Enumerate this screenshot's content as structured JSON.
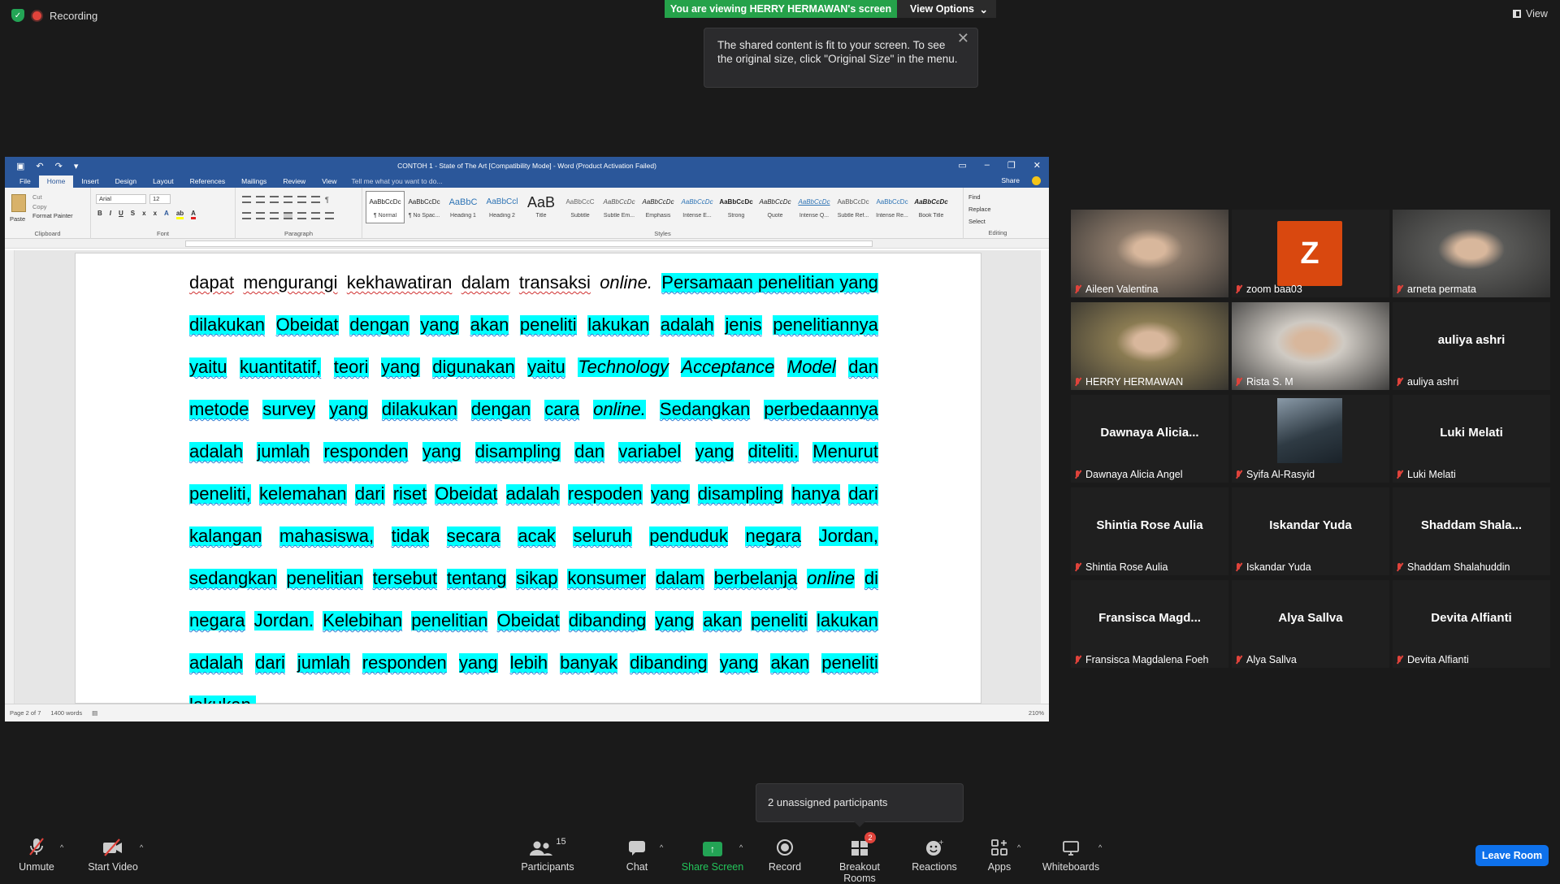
{
  "top": {
    "recording": "Recording",
    "viewing_banner": "You are viewing HERRY HERMAWAN's screen",
    "view_options": "View Options",
    "tooltip": "The shared content is fit to your screen. To see the original size, click \"Original Size\" in the menu.",
    "view_label": "View"
  },
  "word": {
    "title": "CONTOH 1 - State of The Art [Compatibility Mode] - Word (Product Activation Failed)",
    "tabs": [
      "File",
      "Home",
      "Insert",
      "Design",
      "Layout",
      "References",
      "Mailings",
      "Review",
      "View"
    ],
    "tell_me": "Tell me what you want to do...",
    "share": "Share",
    "clipboard": {
      "paste": "Paste",
      "cut": "Cut",
      "copy": "Copy",
      "format_painter": "Format Painter",
      "label": "Clipboard"
    },
    "font": {
      "name": "Arial",
      "size": "12",
      "label": "Font"
    },
    "paragraph_label": "Paragraph",
    "styles_label": "Styles",
    "styles": [
      {
        "preview": "AaBbCcDc",
        "name": "¶ Normal"
      },
      {
        "preview": "AaBbCcDc",
        "name": "¶ No Spac..."
      },
      {
        "preview": "AaBbC",
        "name": "Heading 1"
      },
      {
        "preview": "AaBbCcl",
        "name": "Heading 2"
      },
      {
        "preview": "AaB",
        "name": "Title"
      },
      {
        "preview": "AaBbCcC",
        "name": "Subtitle"
      },
      {
        "preview": "AaBbCcDc",
        "name": "Subtle Em..."
      },
      {
        "preview": "AaBbCcDc",
        "name": "Emphasis"
      },
      {
        "preview": "AaBbCcDc",
        "name": "Intense E..."
      },
      {
        "preview": "AaBbCcDc",
        "name": "Strong"
      },
      {
        "preview": "AaBbCcDc",
        "name": "Quote"
      },
      {
        "preview": "AaBbCcDc",
        "name": "Intense Q..."
      },
      {
        "preview": "AaBbCcDc",
        "name": "Subtle Ref..."
      },
      {
        "preview": "AaBbCcDc",
        "name": "Intense Re..."
      },
      {
        "preview": "AaBbCcDc",
        "name": "Book Title"
      }
    ],
    "editing": {
      "find": "Find",
      "replace": "Replace",
      "select": "Select",
      "label": "Editing"
    },
    "status": {
      "page": "Page 2 of 7",
      "words": "1400 words",
      "zoom": "210%"
    },
    "lines": [
      {
        "segs": [
          {
            "t": "dapat",
            "c": "sqr"
          },
          {
            "t": "mengurangi",
            "c": "sqr"
          },
          {
            "t": "kekhawatiran",
            "c": "sqr"
          },
          {
            "t": "dalam",
            "c": "sqr"
          },
          {
            "t": "transaksi",
            "c": "sqr"
          },
          {
            "t": "online.",
            "c": "it"
          },
          {
            "t": "Persamaan penelitian yang",
            "c": "hl sq"
          }
        ]
      },
      {
        "segs": [
          {
            "t": "dilakukan",
            "c": "hl sq"
          },
          {
            "t": "Obeidat",
            "c": "hl sq"
          },
          {
            "t": "dengan",
            "c": "hl sq"
          },
          {
            "t": "yang",
            "c": "hl sq"
          },
          {
            "t": "akan",
            "c": "hl sq"
          },
          {
            "t": "peneliti",
            "c": "hl sq"
          },
          {
            "t": "lakukan",
            "c": "hl sq"
          },
          {
            "t": "adalah",
            "c": "hl sq"
          },
          {
            "t": "jenis",
            "c": "hl sq"
          },
          {
            "t": "penelitiannya",
            "c": "hl sq"
          }
        ]
      },
      {
        "segs": [
          {
            "t": "yaitu",
            "c": "hl sq"
          },
          {
            "t": "kuantitatif,",
            "c": "hl sq"
          },
          {
            "t": "teori",
            "c": "hl sq"
          },
          {
            "t": "yang",
            "c": "hl sq"
          },
          {
            "t": "digunakan",
            "c": "hl sq"
          },
          {
            "t": "yaitu",
            "c": "hl sq"
          },
          {
            "t": "Technology",
            "c": "hl it"
          },
          {
            "t": "Acceptance",
            "c": "hl it"
          },
          {
            "t": "Model",
            "c": "hl it"
          },
          {
            "t": "dan",
            "c": "hl sq"
          }
        ]
      },
      {
        "segs": [
          {
            "t": "metode",
            "c": "hl sq"
          },
          {
            "t": "survey",
            "c": "hl"
          },
          {
            "t": "yang",
            "c": "hl sq"
          },
          {
            "t": "dilakukan",
            "c": "hl sq"
          },
          {
            "t": "dengan",
            "c": "hl sq"
          },
          {
            "t": "cara",
            "c": "hl sq"
          },
          {
            "t": "online.",
            "c": "hl it"
          },
          {
            "t": "Sedangkan",
            "c": "hl sq"
          },
          {
            "t": "perbedaannya",
            "c": "hl sq"
          }
        ]
      },
      {
        "segs": [
          {
            "t": "adalah",
            "c": "hl sq"
          },
          {
            "t": "jumlah",
            "c": "hl sq"
          },
          {
            "t": "responden",
            "c": "hl sq"
          },
          {
            "t": "yang",
            "c": "hl sq"
          },
          {
            "t": "disampling",
            "c": "hl sq"
          },
          {
            "t": "dan",
            "c": "hl sq"
          },
          {
            "t": "variabel",
            "c": "hl sq"
          },
          {
            "t": "yang",
            "c": "hl sq"
          },
          {
            "t": "diteliti.",
            "c": "hl sq"
          },
          {
            "t": "Menurut",
            "c": "hl sq"
          }
        ]
      },
      {
        "segs": [
          {
            "t": "peneliti,",
            "c": "hl sq"
          },
          {
            "t": "kelemahan",
            "c": "hl sq"
          },
          {
            "t": "dari",
            "c": "hl sq"
          },
          {
            "t": "riset",
            "c": "hl sq"
          },
          {
            "t": "Obeidat",
            "c": "hl sq"
          },
          {
            "t": "adalah",
            "c": "hl sq"
          },
          {
            "t": "respoden",
            "c": "hl sq"
          },
          {
            "t": "yang",
            "c": "hl sq"
          },
          {
            "t": "disampling",
            "c": "hl sq"
          },
          {
            "t": "hanya",
            "c": "hl sq"
          },
          {
            "t": "dari",
            "c": "hl sq"
          }
        ]
      },
      {
        "segs": [
          {
            "t": "kalangan",
            "c": "hl sq"
          },
          {
            "t": "mahasiswa,",
            "c": "hl sq"
          },
          {
            "t": "tidak",
            "c": "hl sq"
          },
          {
            "t": "secara",
            "c": "hl sq"
          },
          {
            "t": "acak",
            "c": "hl sq"
          },
          {
            "t": "seluruh",
            "c": "hl sq"
          },
          {
            "t": "penduduk",
            "c": "hl sq"
          },
          {
            "t": "negara",
            "c": "hl sq"
          },
          {
            "t": "Jordan,",
            "c": "hl"
          }
        ]
      },
      {
        "segs": [
          {
            "t": "sedangkan",
            "c": "hl sq"
          },
          {
            "t": "penelitian",
            "c": "hl sq"
          },
          {
            "t": "tersebut",
            "c": "hl sq"
          },
          {
            "t": "tentang",
            "c": "hl sq"
          },
          {
            "t": "sikap",
            "c": "hl sq"
          },
          {
            "t": "konsumer",
            "c": "hl sq"
          },
          {
            "t": "dalam",
            "c": "hl sq"
          },
          {
            "t": "berbelanja",
            "c": "hl sq"
          },
          {
            "t": "online",
            "c": "hl it"
          },
          {
            "t": "di",
            "c": "hl sq"
          }
        ]
      },
      {
        "segs": [
          {
            "t": "negara",
            "c": "hl sq"
          },
          {
            "t": "Jordan.",
            "c": "hl"
          },
          {
            "t": "Kelebihan",
            "c": "hl sq"
          },
          {
            "t": "penelitian",
            "c": "hl sq"
          },
          {
            "t": "Obeidat",
            "c": "hl sq"
          },
          {
            "t": "dibanding",
            "c": "hl sq"
          },
          {
            "t": "yang",
            "c": "hl sq"
          },
          {
            "t": "akan",
            "c": "hl sq"
          },
          {
            "t": "peneliti",
            "c": "hl sq"
          },
          {
            "t": "lakukan",
            "c": "hl sq"
          }
        ]
      },
      {
        "segs": [
          {
            "t": "adalah",
            "c": "hl sq"
          },
          {
            "t": "dari",
            "c": "hl sq"
          },
          {
            "t": "jumlah",
            "c": "hl sq"
          },
          {
            "t": "responden",
            "c": "hl sq"
          },
          {
            "t": "yang",
            "c": "hl sq"
          },
          {
            "t": "lebih",
            "c": "hl sq"
          },
          {
            "t": "banyak",
            "c": "hl sq"
          },
          {
            "t": "dibanding",
            "c": "hl sq"
          },
          {
            "t": "yang",
            "c": "hl sq"
          },
          {
            "t": "akan",
            "c": "hl sq"
          },
          {
            "t": "peneliti",
            "c": "hl sq"
          }
        ]
      },
      {
        "segs": [
          {
            "t": "lakukan.",
            "c": "hl sq"
          }
        ]
      }
    ]
  },
  "participants": [
    {
      "name": "Aileen Valentina",
      "kind": "video",
      "bg": "#8c7a6a"
    },
    {
      "name": "zoom baa03",
      "kind": "avatar",
      "initial": "Z"
    },
    {
      "name": "arneta permata",
      "kind": "video",
      "bg": "#5a5a58"
    },
    {
      "name": "HERRY HERMAWAN",
      "kind": "video",
      "bg": "#8a7b52",
      "active": true
    },
    {
      "name": "Rista S. M",
      "kind": "video",
      "bg": "#cfcac3"
    },
    {
      "name": "auliya ashri",
      "kind": "name",
      "display": "auliya ashri"
    },
    {
      "name": "Dawnaya Alicia Angel",
      "kind": "name",
      "display": "Dawnaya  Alicia..."
    },
    {
      "name": "Syifa Al-Rasyid",
      "kind": "picture"
    },
    {
      "name": "Luki Melati",
      "kind": "name",
      "display": "Luki Melati"
    },
    {
      "name": "Shintia Rose Aulia",
      "kind": "name",
      "display": "Shintia Rose Aulia"
    },
    {
      "name": "Iskandar Yuda",
      "kind": "name",
      "display": "Iskandar Yuda"
    },
    {
      "name": "Shaddam Shalahuddin",
      "kind": "name",
      "display": "Shaddam  Shala..."
    },
    {
      "name": "Fransisca Magdalena Foeh",
      "kind": "name",
      "display": "Fransisca  Magd..."
    },
    {
      "name": "Alya Sallva",
      "kind": "name",
      "display": "Alya Sallva"
    },
    {
      "name": "Devita Alfianti",
      "kind": "name",
      "display": "Devita Alfianti"
    }
  ],
  "unassigned": "2 unassigned participants",
  "toolbar": {
    "unmute": "Unmute",
    "start_video": "Start Video",
    "participants": "Participants",
    "participants_count": "15",
    "chat": "Chat",
    "share_screen": "Share Screen",
    "record": "Record",
    "breakout_rooms": "Breakout Rooms",
    "breakout_badge": "2",
    "reactions": "Reactions",
    "apps": "Apps",
    "whiteboards": "Whiteboards",
    "leave": "Leave Room"
  },
  "colors": {
    "zoom_green": "#25a24a",
    "word_blue": "#2b579a",
    "leave_blue": "#0e71eb",
    "highlight": "#00ffff",
    "avatar_orange": "#d9480f",
    "active_speaker": "#ddde3a"
  }
}
